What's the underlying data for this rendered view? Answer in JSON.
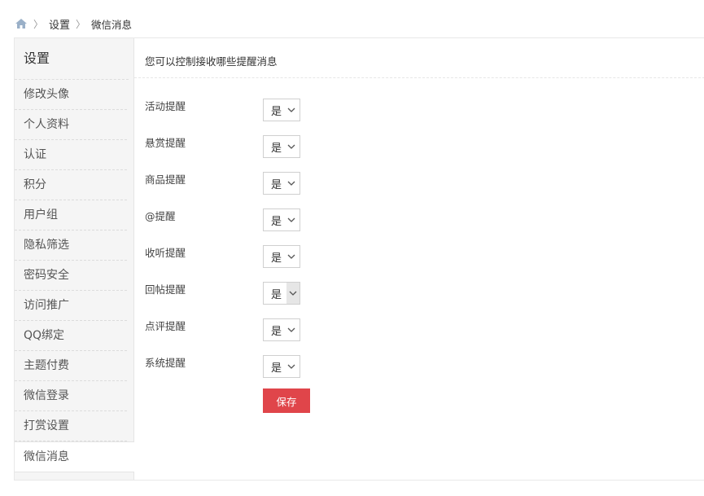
{
  "breadcrumb": {
    "level1": "设置",
    "level2": "微信消息"
  },
  "sidebar": {
    "title": "设置",
    "items": [
      {
        "label": "修改头像"
      },
      {
        "label": "个人资料"
      },
      {
        "label": "认证"
      },
      {
        "label": "积分"
      },
      {
        "label": "用户组"
      },
      {
        "label": "隐私筛选"
      },
      {
        "label": "密码安全"
      },
      {
        "label": "访问推广"
      },
      {
        "label": "QQ绑定"
      },
      {
        "label": "主题付费"
      },
      {
        "label": "微信登录"
      },
      {
        "label": "打赏设置"
      },
      {
        "label": "微信消息"
      }
    ]
  },
  "main": {
    "intro": "您可以控制接收哪些提醒消息",
    "settings": [
      {
        "label": "活动提醒",
        "value": "是"
      },
      {
        "label": "悬赏提醒",
        "value": "是"
      },
      {
        "label": "商品提醒",
        "value": "是"
      },
      {
        "label": "@提醒",
        "value": "是"
      },
      {
        "label": "收听提醒",
        "value": "是"
      },
      {
        "label": "回帖提醒",
        "value": "是"
      },
      {
        "label": "点评提醒",
        "value": "是"
      },
      {
        "label": "系统提醒",
        "value": "是"
      }
    ],
    "save_label": "保存"
  },
  "colors": {
    "accent": "#e0454a",
    "sidebar_bg": "#f5f5f5"
  }
}
